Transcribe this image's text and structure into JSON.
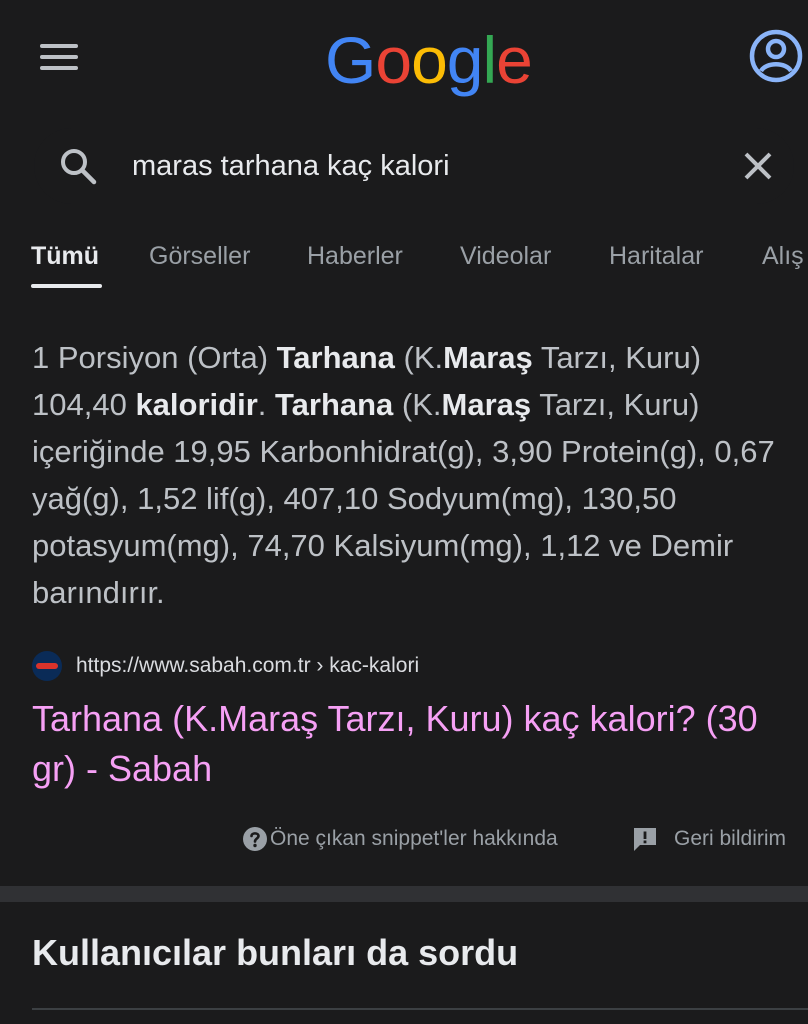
{
  "header": {
    "logo_letters": [
      {
        "ch": "G",
        "color": "#4285f4"
      },
      {
        "ch": "o",
        "color": "#ea4335"
      },
      {
        "ch": "o",
        "color": "#fbbc05"
      },
      {
        "ch": "g",
        "color": "#4285f4"
      },
      {
        "ch": "l",
        "color": "#34a853"
      },
      {
        "ch": "e",
        "color": "#ea4335"
      }
    ],
    "menu_icon": "hamburger-icon",
    "account_icon": "account-circle-icon",
    "account_color": "#8ab4f8"
  },
  "search": {
    "query": "maras tarhana kaç kalori",
    "search_icon": "search-icon",
    "clear_icon": "close-icon"
  },
  "tabs": [
    {
      "label": "Tümü",
      "active": true
    },
    {
      "label": "Görseller",
      "active": false
    },
    {
      "label": "Haberler",
      "active": false
    },
    {
      "label": "Videolar",
      "active": false
    },
    {
      "label": "Haritalar",
      "active": false
    },
    {
      "label": "Alış",
      "active": false
    }
  ],
  "snippet": {
    "segments": [
      {
        "t": "1 Porsiyon (Orta) ",
        "b": false
      },
      {
        "t": "Tarhana",
        "b": true
      },
      {
        "t": " (K.",
        "b": false
      },
      {
        "t": "Maraş",
        "b": true
      },
      {
        "t": " Tarzı, Kuru) 104,40 ",
        "b": false
      },
      {
        "t": "kaloridir",
        "b": true
      },
      {
        "t": ". ",
        "b": false
      },
      {
        "t": "Tarhana",
        "b": true
      },
      {
        "t": " (K.",
        "b": false
      },
      {
        "t": "Maraş",
        "b": true
      },
      {
        "t": " Tarzı, Kuru) içeriğinde 19,95 Karbonhidrat(g), 3,90 Protein(g), 0,67 yağ(g), 1,52 lif(g), 407,10 Sodyum(mg), 130,50 potasyum(mg), 74,70 Kalsiyum(mg), 1,12 ve Demir barındırır.",
        "b": false
      }
    ]
  },
  "result": {
    "favicon": "sabah-favicon",
    "url": "https://www.sabah.com.tr › kac-kalori",
    "title": "Tarhana (K.Maraş Tarzı, Kuru) kaç kalori? (30 gr) - Sabah",
    "title_color": "#f6a0f5"
  },
  "footer_links": {
    "about_label": "Öne çıkan snippet'ler hakkında",
    "feedback_label": "Geri bildirim"
  },
  "people_also_ask": {
    "title": "Kullanıcılar bunları da sordu"
  }
}
